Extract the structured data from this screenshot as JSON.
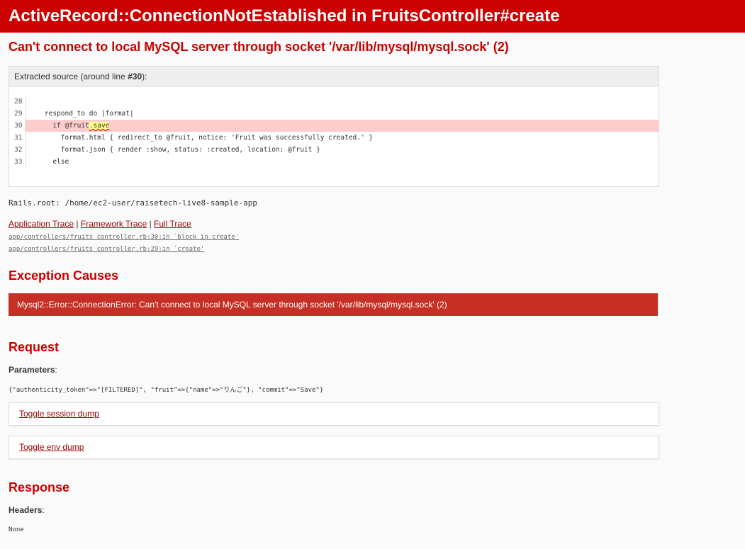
{
  "header": {
    "title": "ActiveRecord::ConnectionNotEstablished in FruitsController#create",
    "bg_color": "#cc0000"
  },
  "error_message": "Can't connect to local MySQL server through socket '/var/lib/mysql/mysql.sock' (2)",
  "source": {
    "header_prefix": "Extracted source (around line ",
    "header_line": "#30",
    "header_suffix": "):",
    "lines": [
      {
        "num": "28",
        "code": ""
      },
      {
        "num": "29",
        "code": "    respond_to do |format|"
      },
      {
        "num": "30",
        "code_pre": "      if @fruit",
        "code_err": ".save",
        "highlight": true
      },
      {
        "num": "31",
        "code": "        format.html { redirect_to @fruit, notice: 'Fruit was successfully created.' }"
      },
      {
        "num": "32",
        "code": "        format.json { render :show, status: :created, location: @fruit }"
      },
      {
        "num": "33",
        "code": "      else"
      }
    ]
  },
  "rails_root": "Rails.root: /home/ec2-user/raisetech-live8-sample-app",
  "traces": {
    "application": "Application Trace",
    "framework": "Framework Trace",
    "full": "Full Trace",
    "sep": "|",
    "lines": [
      "app/controllers/fruits_controller.rb:30:in `block in create'",
      "app/controllers/fruits_controller.rb:29:in `create'"
    ]
  },
  "exception_causes": {
    "title": "Exception Causes",
    "cause": "Mysql2::Error::ConnectionError: Can't connect to local MySQL server through socket '/var/lib/mysql/mysql.sock' (2)",
    "bg_color": "#c52f24"
  },
  "request": {
    "title": "Request",
    "params_label": "Parameters",
    "params_colon": ":",
    "params_value": "{\"authenticity_token\"=>\"[FILTERED]\", \"fruit\"=>{\"name\"=>\"りんご\"}, \"commit\"=>\"Save\"}",
    "toggle_session": "Toggle session dump",
    "toggle_env": "Toggle env dump"
  },
  "response": {
    "title": "Response",
    "headers_label": "Headers",
    "headers_colon": ":",
    "headers_value": "None"
  }
}
